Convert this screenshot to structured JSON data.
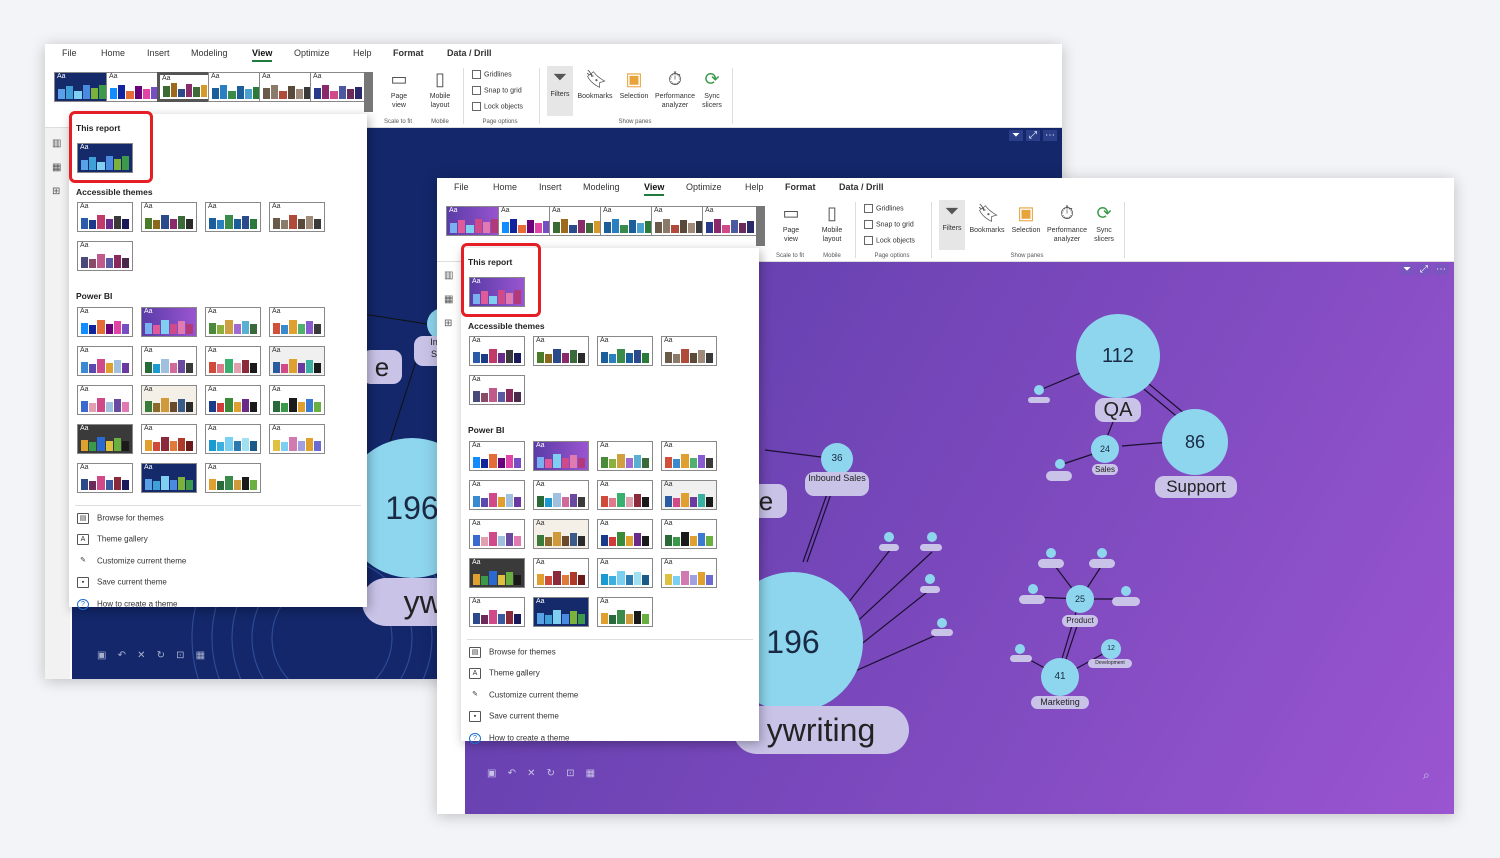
{
  "menu_tabs": [
    "File",
    "Home",
    "Insert",
    "Modeling",
    "View",
    "Optimize",
    "Help",
    "Format",
    "Data / Drill"
  ],
  "active_tab": "View",
  "ribbon": {
    "page_view": "Page view",
    "mobile_layout": "Mobile layout",
    "gridlines": "Gridlines",
    "snap_to_grid": "Snap to grid",
    "lock_objects": "Lock objects",
    "filters": "Filters",
    "bookmarks": "Bookmarks",
    "selection": "Selection",
    "performance_analyzer": "Performance analyzer",
    "sync_slicers": "Sync slicers",
    "group_scale": "Scale to fit",
    "group_mobile": "Mobile",
    "group_page_options": "Page options",
    "group_show_panes": "Show panes"
  },
  "theme_menu": {
    "this_report": "This report",
    "accessible_themes": "Accessible themes",
    "power_bi": "Power BI",
    "aa": "Aa",
    "links": [
      "Browse for themes",
      "Theme gallery",
      "Customize current theme",
      "Save current theme",
      "How to create a theme"
    ]
  },
  "colors": {
    "win1_canvas": "#13276a",
    "win2_canvas_start": "#5a3ca8",
    "win2_canvas_end": "#9a55d0",
    "node": "#8dd6ee",
    "label_bg": "#c9c3e8",
    "highlight": "#e41e24",
    "active_tab_underline": "#1f7a3c"
  },
  "win1_canvas": {
    "big_node_value": "196",
    "big_label_fragment": "ywri",
    "label_fragment_in": "In",
    "label_fragment_s": "S",
    "label_fragment_e": "e"
  },
  "win2_canvas": {
    "qa_value": "112",
    "qa_label": "QA",
    "support_value": "86",
    "support_label": "Support",
    "sales_value": "24",
    "sales_label": "Sales",
    "inbound_value": "36",
    "inbound_label": "Inbound Sales",
    "big_value": "196",
    "big_label": "ywriting",
    "product_value": "25",
    "product_label": "Product",
    "marketing_value": "41",
    "marketing_label": "Marketing",
    "development_value": "12",
    "development_label": "Development",
    "partial_label": "e"
  },
  "icons": [
    "filter-icon",
    "expand-icon",
    "more-icon",
    "search-icon",
    "undo-icon",
    "shuffle-icon",
    "refresh-icon",
    "lock-icon",
    "grid-icon",
    "report-view-icon",
    "table-view-icon",
    "model-view-icon"
  ]
}
